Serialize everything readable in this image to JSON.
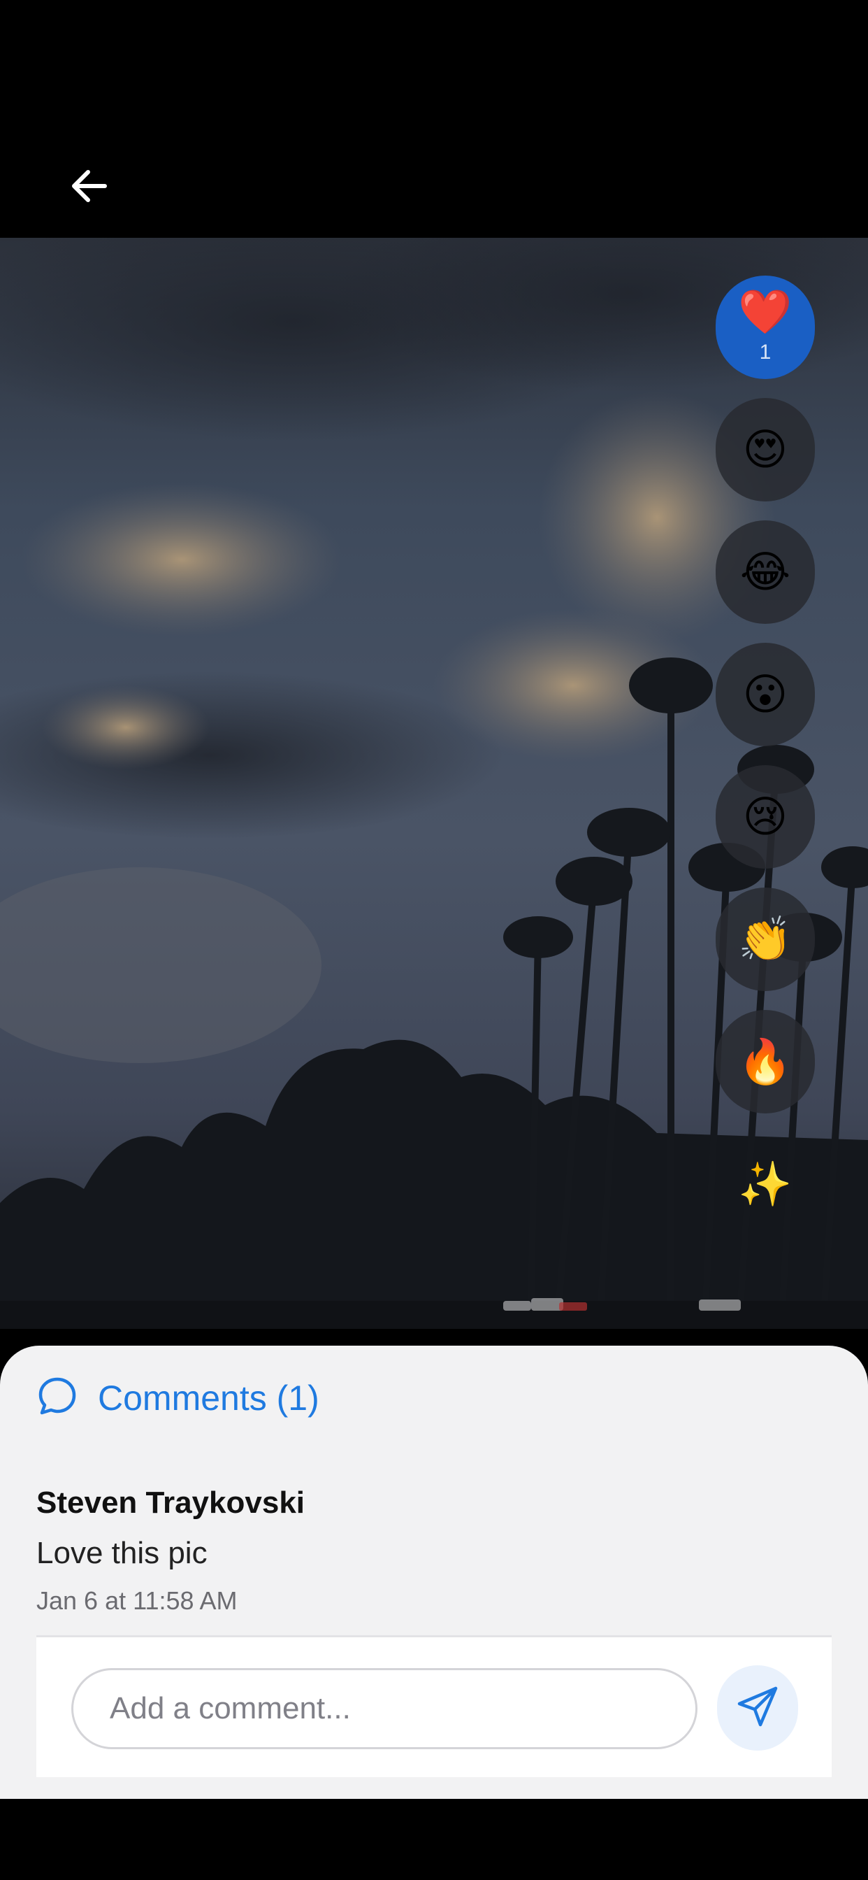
{
  "header": {
    "back_icon": "arrow-left-icon"
  },
  "photo": {
    "description_icon": "photo"
  },
  "reactions": [
    {
      "emoji": "❤️",
      "name": "heart",
      "count": "1",
      "active": true
    },
    {
      "emoji": "😍",
      "name": "heart-eyes",
      "count": "",
      "active": false
    },
    {
      "emoji": "😂",
      "name": "laughing",
      "count": "",
      "active": false
    },
    {
      "emoji": "😮",
      "name": "surprised",
      "count": "",
      "active": false
    },
    {
      "emoji": "😢",
      "name": "crying",
      "count": "",
      "active": false
    },
    {
      "emoji": "👏",
      "name": "clapping",
      "count": "",
      "active": false
    },
    {
      "emoji": "🔥",
      "name": "fire",
      "count": "",
      "active": false
    },
    {
      "emoji": "✨",
      "name": "sparkles",
      "count": "",
      "active": false
    }
  ],
  "comments": {
    "title": "Comments (1)",
    "icon": "speech-bubble-icon",
    "accent_color": "#1f7ae0",
    "items": [
      {
        "author": "Steven Traykovski",
        "text": "Love this pic",
        "timestamp": "Jan 6 at 11:58 AM"
      }
    ],
    "input_placeholder": "Add a comment...",
    "input_value": "",
    "send_icon": "send-icon"
  }
}
